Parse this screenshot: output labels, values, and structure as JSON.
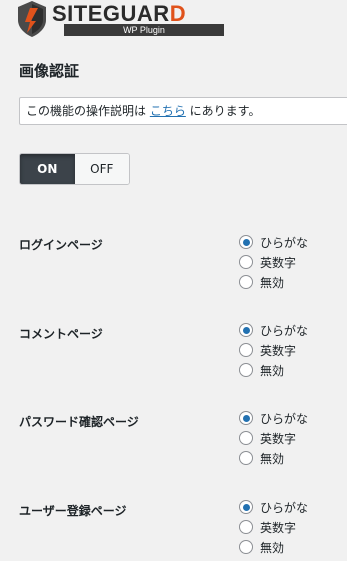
{
  "logo": {
    "word_main": "SITEGUAR",
    "word_accent": "D",
    "subtitle": "WP Plugin"
  },
  "page": {
    "title": "画像認証"
  },
  "notice": {
    "text_before": "この機能の操作説明は ",
    "link_text": "こちら",
    "text_after": " にあります。"
  },
  "toggle": {
    "on_label": "ON",
    "off_label": "OFF",
    "state": "ON"
  },
  "options": {
    "hiragana": "ひらがな",
    "alnum": "英数字",
    "disabled": "無効"
  },
  "sections": [
    {
      "label": "ログインページ",
      "selected": "ひらがな"
    },
    {
      "label": "コメントページ",
      "selected": "ひらがな"
    },
    {
      "label": "パスワード確認ページ",
      "selected": "ひらがな"
    },
    {
      "label": "ユーザー登録ページ",
      "selected": "ひらがな"
    }
  ],
  "colors": {
    "accent": "#e0521b",
    "link": "#2271b1",
    "radio_checked": "#2271b1",
    "toggle_on_bg": "#3c434a"
  }
}
